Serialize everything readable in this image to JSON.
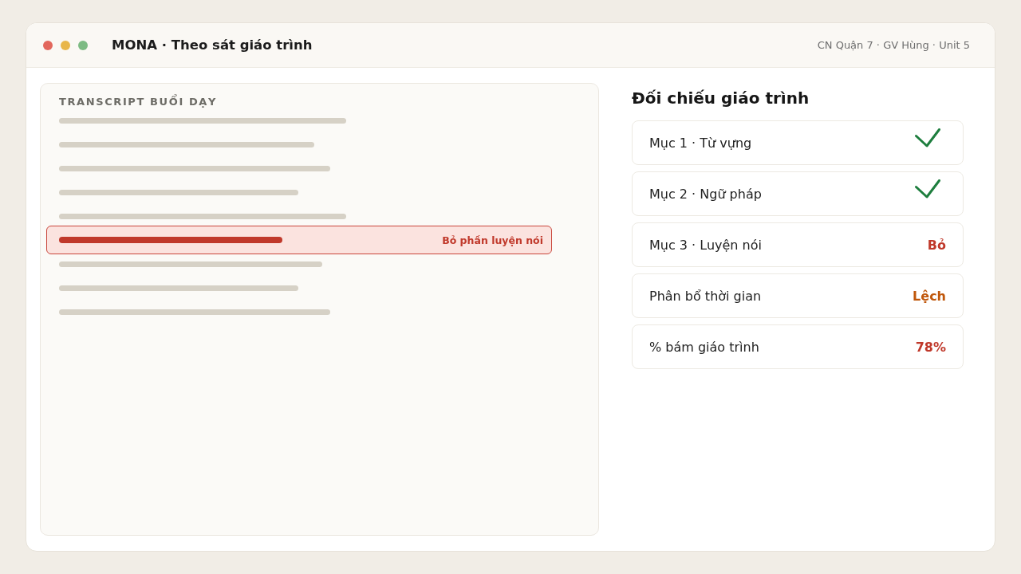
{
  "window": {
    "title": "MONA · Theo sát giáo trình",
    "context": "CN Quận 7 · GV Hùng · Unit 5"
  },
  "transcript": {
    "title": "TRANSCRIPT BUỔI DẠY",
    "lines": [
      {
        "flagged": false
      },
      {
        "flagged": false
      },
      {
        "flagged": false
      },
      {
        "flagged": false
      },
      {
        "flagged": false
      },
      {
        "flagged": true,
        "note": "Bỏ phần luyện nói"
      },
      {
        "flagged": false
      },
      {
        "flagged": false
      },
      {
        "flagged": false
      }
    ]
  },
  "comparison": {
    "title": "Đối chiếu giáo trình",
    "rows": [
      {
        "label": "Mục 1 · Từ vựng",
        "kind": "check"
      },
      {
        "label": "Mục 2 · Ngữ pháp",
        "kind": "check"
      },
      {
        "label": "Mục 3 · Luyện nói",
        "kind": "value",
        "value": "Bỏ",
        "color": "#c0392b"
      },
      {
        "label": "Phân bổ thời gian",
        "kind": "value",
        "value": "Lệch",
        "color": "#c0570b"
      },
      {
        "label": "% bám giáo trình",
        "kind": "value",
        "value": "78%",
        "color": "#c0392b"
      }
    ]
  }
}
